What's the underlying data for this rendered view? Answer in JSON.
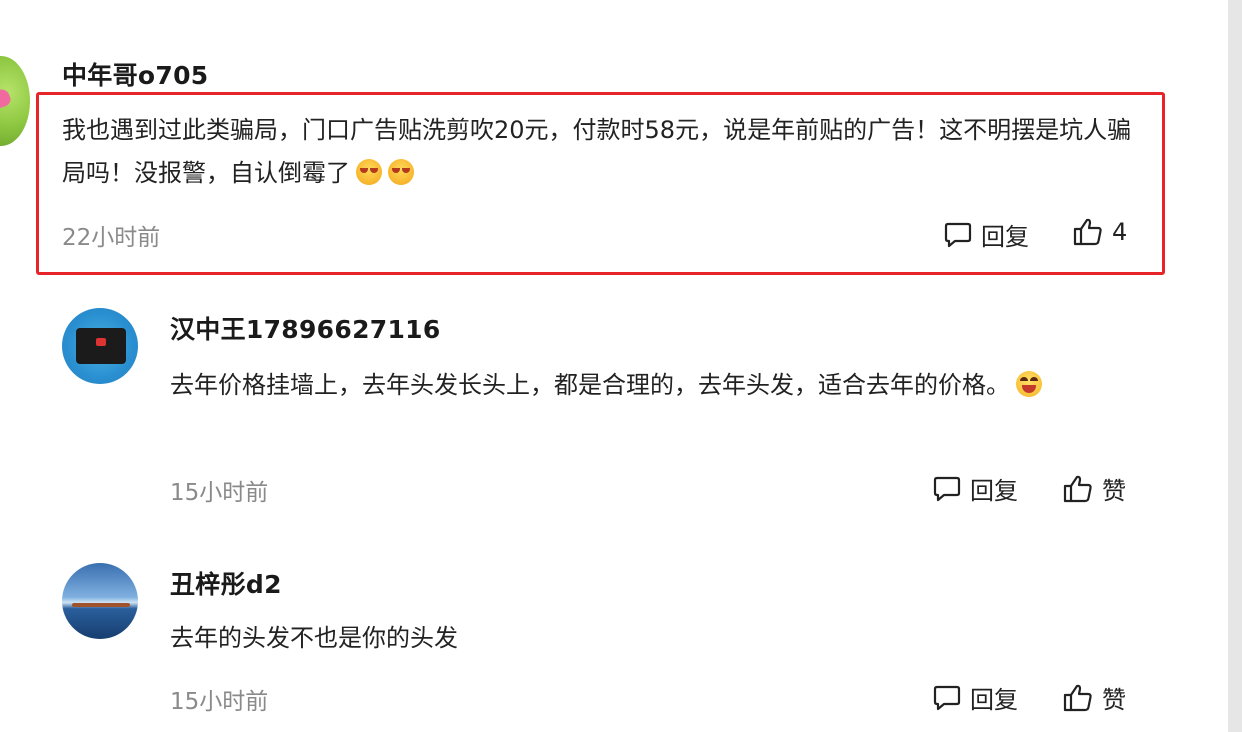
{
  "comments": [
    {
      "username": "中年哥o705",
      "text": "我也遇到过此类骗局，门口广告贴洗剪吹20元，付款时58元，说是年前贴的广告！这不明摆是坑人骗局吗！没报警，自认倒霉了",
      "time": "22小时前",
      "reply_label": "回复",
      "like_label": "4",
      "emoji_count": 2
    },
    {
      "username": "汉中王17896627116",
      "text": "去年价格挂墙上，去年头发长头上，都是合理的，去年头发，适合去年的价格。",
      "time": "15小时前",
      "reply_label": "回复",
      "like_label": "赞",
      "emoji_count": 1
    },
    {
      "username": "丑梓彤d2",
      "text": "去年的头发不也是你的头发",
      "time": "15小时前",
      "reply_label": "回复",
      "like_label": "赞",
      "emoji_count": 0
    }
  ],
  "icons": {
    "reply": "comment-bubble-icon",
    "like": "thumbs-up-icon"
  },
  "colors": {
    "highlight_border": "#e8242b",
    "time_text": "#8a8a8a",
    "primary_text": "#222222"
  }
}
